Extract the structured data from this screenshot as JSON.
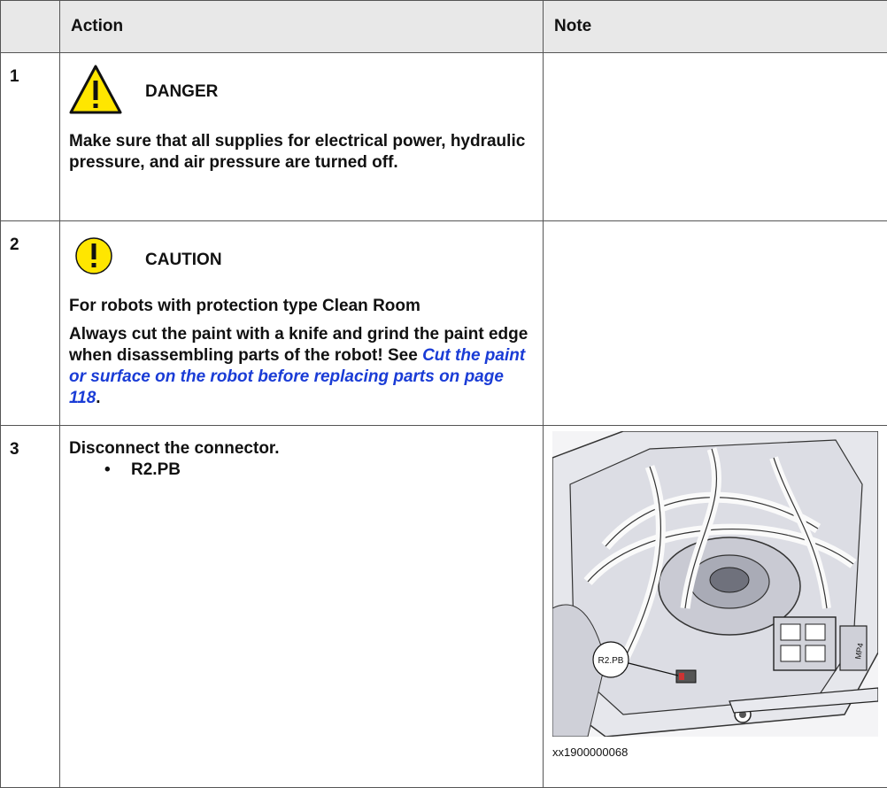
{
  "header": {
    "num": "",
    "action": "Action",
    "note": "Note"
  },
  "rows": [
    {
      "num": "1",
      "warning_label": "DANGER",
      "text": "Make sure that all supplies for electrical power, hydraulic pressure, and air pressure are turned off."
    },
    {
      "num": "2",
      "warning_label": "CAUTION",
      "subheading": "For robots with protection type Clean Room",
      "text": "Always cut the paint with a knife and grind the paint edge when disassembling parts of the robot! See ",
      "link_text": "Cut the paint or surface on the robot before replacing parts on page 118",
      "text_after": "."
    },
    {
      "num": "3",
      "text": "Disconnect the connector.",
      "bullet": "R2.PB",
      "figure_label": "R2.PB",
      "figure_tag": "MP4",
      "caption": "xx1900000068"
    }
  ],
  "colors": {
    "danger": "#ffe600",
    "caution": "#ffe600",
    "link": "#1a3cd6",
    "header_bg": "#e8e8e8"
  }
}
